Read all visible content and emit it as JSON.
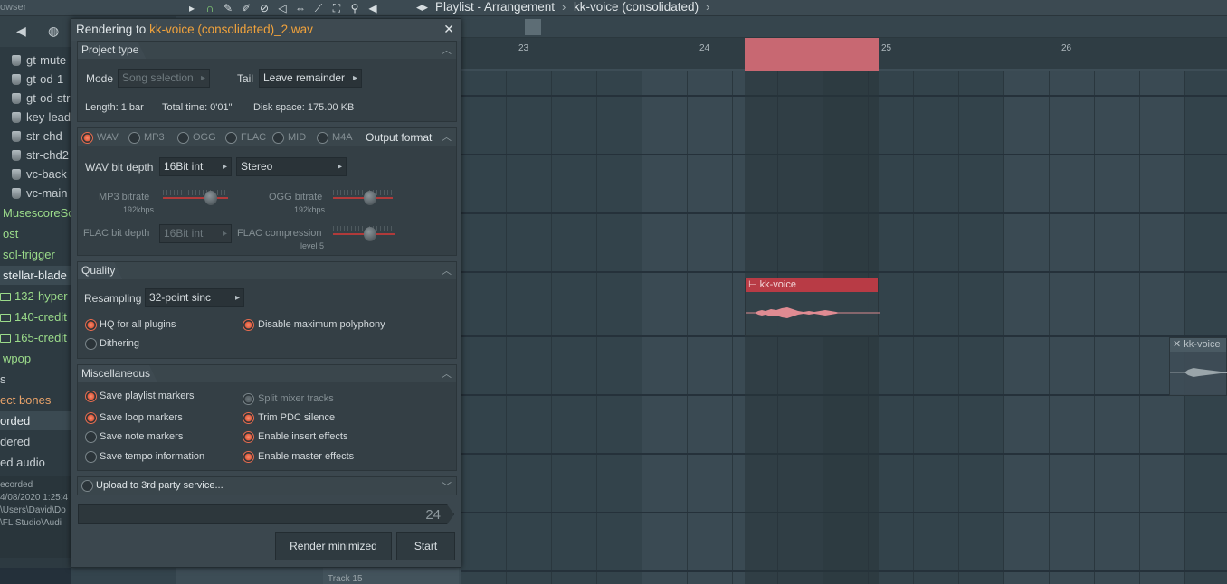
{
  "topbar": {
    "browser_label": "owser",
    "playlist_title": "Playlist - Arrangement",
    "crumb_separator": "›",
    "pattern_name": "kk-voice (consolidated)",
    "crumb_end": "›"
  },
  "sidebar": {
    "items": [
      {
        "label": "gt-mute"
      },
      {
        "label": "gt-od-1"
      },
      {
        "label": "gt-od-str"
      },
      {
        "label": "key-lead"
      },
      {
        "label": "str-chd"
      },
      {
        "label": "str-chd2"
      },
      {
        "label": "vc-back"
      },
      {
        "label": "vc-main"
      }
    ],
    "folders": [
      {
        "label": "MusescoreSc"
      },
      {
        "label": "ost"
      },
      {
        "label": "sol-trigger"
      },
      {
        "label": "stellar-blade"
      },
      {
        "label": "132-hyper"
      },
      {
        "label": "140-credit"
      },
      {
        "label": "165-credit"
      },
      {
        "label": "wpop"
      },
      {
        "label": "s"
      },
      {
        "label": "ect bones"
      },
      {
        "label": "orded"
      },
      {
        "label": "dered"
      },
      {
        "label": "ed audio"
      }
    ],
    "info": {
      "line1": "ecorded",
      "line2": "4/08/2020 1:25:4",
      "line3": "\\Users\\David\\Do",
      "line4": "\\FL Studio\\Audi"
    }
  },
  "playlist": {
    "ruler": [
      "23",
      "24",
      "25",
      "26"
    ],
    "clip_main_label": "kk-voice",
    "clip_second_label": "kk-voice",
    "track_label": "Track 15"
  },
  "dialog": {
    "title_prefix": "Rendering to ",
    "title_file": "kk-voice (consolidated)_2.wav",
    "project_type": {
      "header": "Project type",
      "mode_label": "Mode",
      "mode_value": "Song selection",
      "tail_label": "Tail",
      "tail_value": "Leave remainder",
      "length": "Length: 1 bar",
      "total_time": "Total time: 0'01\"",
      "disk_space": "Disk space: 175.00 KB"
    },
    "output_format": {
      "header": "Output format",
      "formats": [
        "WAV",
        "MP3",
        "OGG",
        "FLAC",
        "MID",
        "M4A"
      ],
      "wav_bit_depth_label": "WAV bit depth",
      "wav_bit_depth_value": "16Bit int",
      "channels_value": "Stereo",
      "mp3_bitrate_label": "MP3 bitrate",
      "mp3_bitrate_sub": "192kbps",
      "ogg_bitrate_label": "OGG bitrate",
      "ogg_bitrate_sub": "192kbps",
      "flac_bit_depth_label": "FLAC bit depth",
      "flac_bit_depth_value": "16Bit int",
      "flac_compression_label": "FLAC compression",
      "flac_compression_sub": "level 5"
    },
    "quality": {
      "header": "Quality",
      "resampling_label": "Resampling",
      "resampling_value": "32-point sinc",
      "hq_label": "HQ for all plugins",
      "disable_poly_label": "Disable maximum polyphony",
      "dithering_label": "Dithering"
    },
    "misc": {
      "header": "Miscellaneous",
      "save_playlist_markers": "Save playlist markers",
      "split_mixer_tracks": "Split mixer tracks",
      "save_loop_markers": "Save loop markers",
      "trim_pdc_silence": "Trim PDC silence",
      "save_note_markers": "Save note markers",
      "enable_insert_effects": "Enable insert effects",
      "save_tempo_information": "Save tempo information",
      "enable_master_effects": "Enable master effects"
    },
    "upload_label": "Upload to 3rd party service...",
    "progress_value": "24",
    "render_minimized_label": "Render minimized",
    "start_label": "Start"
  },
  "colors": {
    "accent": "#f0a23c",
    "radio_on": "#e45b3d",
    "loop_region": "#c86872",
    "clip_header": "#b83b45"
  }
}
